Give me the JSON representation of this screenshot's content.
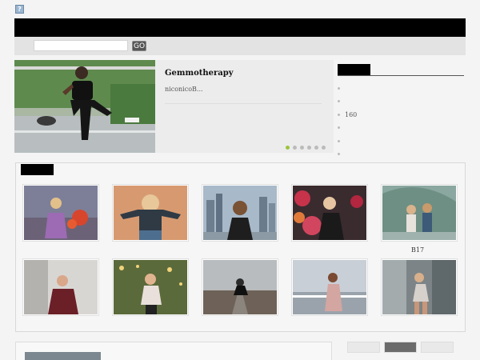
{
  "site": {
    "favicon": "?"
  },
  "search": {
    "placeholder": "",
    "value": "",
    "button_label": "GO"
  },
  "slider": {
    "title": "Gemmotherapy",
    "excerpt": "niconicoB...",
    "dots": 6,
    "active_dot": 1
  },
  "sidebar": {
    "items": [
      "",
      "",
      "160",
      "",
      "",
      ""
    ]
  },
  "gallery": {
    "captions": [
      "",
      "",
      "",
      "",
      "B17",
      "",
      "",
      "",
      "",
      ""
    ]
  },
  "colors": {
    "accent": "#9bc53d",
    "header": "#000000"
  }
}
